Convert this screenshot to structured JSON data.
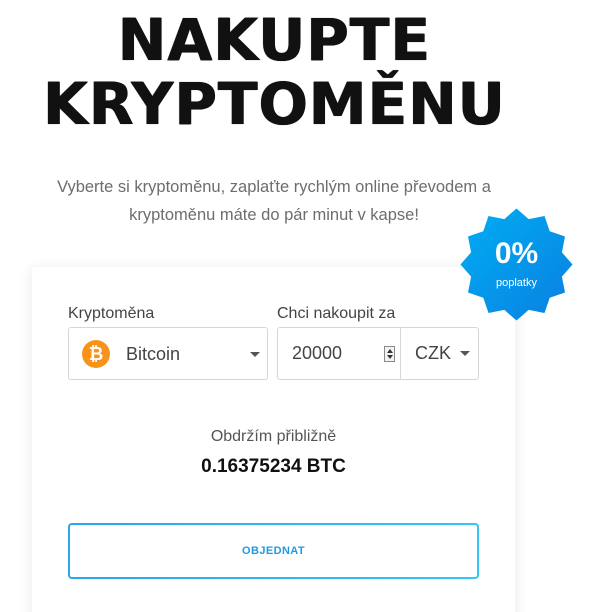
{
  "hero": {
    "title_line1": "NAKUPTE",
    "title_line2": "KRYPTOMĚNU",
    "subtitle_line1": "Vyberte si kryptoměnu, zaplaťte rychlým online převodem a",
    "subtitle_line2": "kryptoměnu máte do pár minut v kapse!"
  },
  "badge": {
    "percent": "0%",
    "label": "poplatky",
    "color_start": "#00aef4",
    "color_end": "#0a7fe0"
  },
  "form": {
    "crypto_label": "Kryptoměna",
    "crypto_value": "Bitcoin",
    "crypto_icon": "bitcoin-icon",
    "crypto_icon_glyph": "₿",
    "amount_label": "Chci nakoupit za",
    "amount_value": "20000",
    "currency_value": "CZK",
    "receive_label": "Obdržím přibližně",
    "receive_value": "0.16375234 BTC",
    "order_button": "OBJEDNAT"
  },
  "colors": {
    "bitcoin": "#f7931a",
    "accent": "#1e9be0"
  }
}
